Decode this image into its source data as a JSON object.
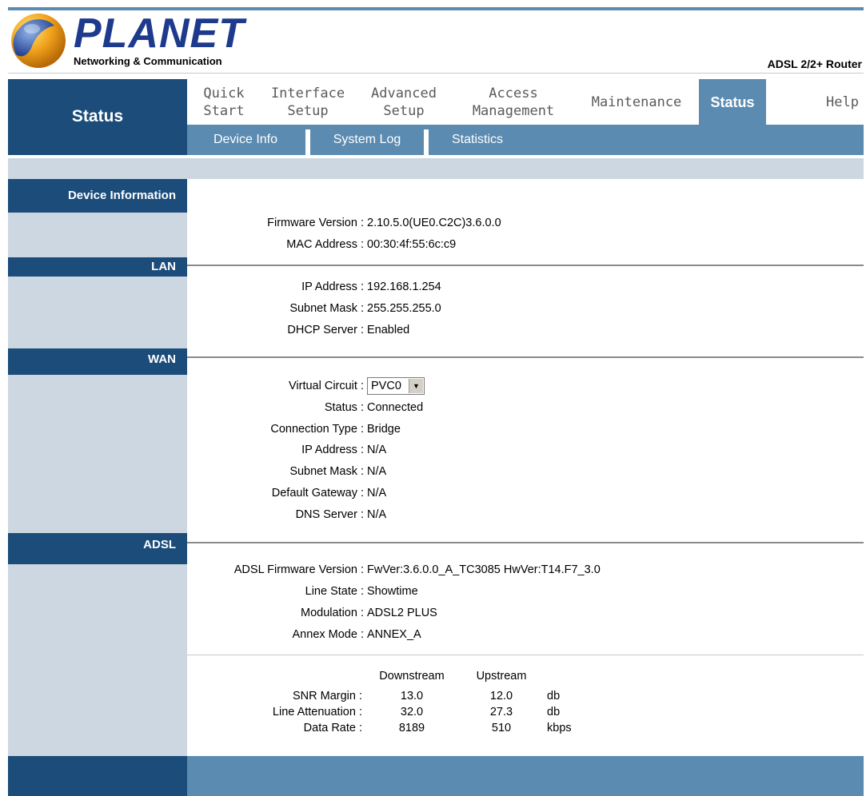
{
  "brand": {
    "logo_text": "PLANET",
    "logo_subtitle": "Networking & Communication",
    "product": "ADSL 2/2+ Router"
  },
  "nav": {
    "section_title": "Status",
    "items": [
      {
        "label": "Quick\nStart"
      },
      {
        "label": "Interface\nSetup"
      },
      {
        "label": "Advanced\nSetup"
      },
      {
        "label": "Access\nManagement"
      },
      {
        "label": "Maintenance"
      },
      {
        "label": "Status"
      },
      {
        "label": "Help"
      }
    ],
    "sub_items": [
      {
        "label": "Device Info"
      },
      {
        "label": "System Log"
      },
      {
        "label": "Statistics"
      }
    ]
  },
  "sections": {
    "device": "Device Information",
    "lan": "LAN",
    "wan": "WAN",
    "adsl": "ADSL"
  },
  "device": {
    "firmware_label": "Firmware Version :",
    "firmware_value": "2.10.5.0(UE0.C2C)3.6.0.0",
    "mac_label": "MAC Address :",
    "mac_value": "00:30:4f:55:6c:c9"
  },
  "lan": {
    "ip_label": "IP Address :",
    "ip_value": "192.168.1.254",
    "mask_label": "Subnet Mask :",
    "mask_value": "255.255.255.0",
    "dhcp_label": "DHCP Server :",
    "dhcp_value": "Enabled"
  },
  "wan": {
    "vc_label": "Virtual Circuit :",
    "vc_value": "PVC0",
    "status_label": "Status :",
    "status_value": "Connected",
    "conn_label": "Connection Type :",
    "conn_value": "Bridge",
    "ip_label": "IP Address :",
    "ip_value": "N/A",
    "mask_label": "Subnet Mask :",
    "mask_value": "N/A",
    "gw_label": "Default Gateway :",
    "gw_value": "N/A",
    "dns_label": "DNS Server :",
    "dns_value": "N/A"
  },
  "adsl": {
    "fw_label": "ADSL Firmware Version :",
    "fw_value": "FwVer:3.6.0.0_A_TC3085 HwVer:T14.F7_3.0",
    "line_label": "Line State :",
    "line_value": "Showtime",
    "mod_label": "Modulation :",
    "mod_value": "ADSL2 PLUS",
    "annex_label": "Annex Mode :",
    "annex_value": "ANNEX_A",
    "stats": {
      "col_down": "Downstream",
      "col_up": "Upstream",
      "rows": [
        {
          "label": "SNR Margin :",
          "down": "13.0",
          "up": "12.0",
          "unit": "db"
        },
        {
          "label": "Line Attenuation :",
          "down": "32.0",
          "up": "27.3",
          "unit": "db"
        },
        {
          "label": "Data Rate :",
          "down": "8189",
          "up": "510",
          "unit": "kbps"
        }
      ]
    }
  }
}
